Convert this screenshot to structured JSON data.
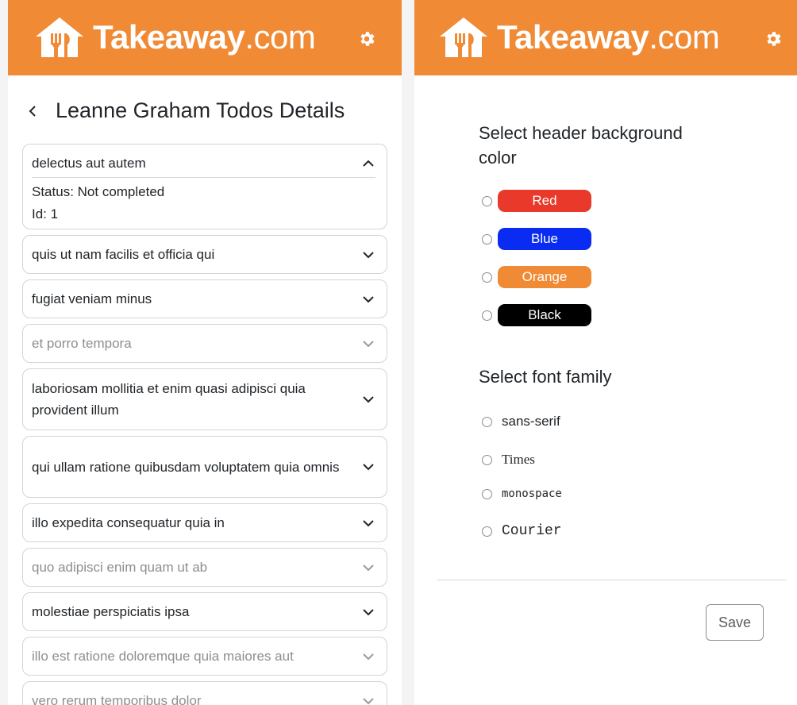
{
  "brand": {
    "primary": "#f08a35",
    "name_bold": "Takeaway",
    "name_light": ".com"
  },
  "left_panel": {
    "title": "Leanne Graham Todos Details",
    "todos": [
      {
        "title": "delectus aut autem",
        "completed": false,
        "expanded": true,
        "status_text": "Status: Not completed",
        "id_text": "Id: 1"
      },
      {
        "title": "quis ut nam facilis et officia qui",
        "completed": false
      },
      {
        "title": "fugiat veniam minus",
        "completed": false
      },
      {
        "title": "et porro tempora",
        "completed": true
      },
      {
        "title": "laboriosam mollitia et enim quasi adipisci quia provident illum",
        "completed": false
      },
      {
        "title": "qui ullam ratione quibusdam voluptatem quia omnis",
        "completed": false
      },
      {
        "title": "illo expedita consequatur quia in",
        "completed": false
      },
      {
        "title": "quo adipisci enim quam ut ab",
        "completed": true
      },
      {
        "title": "molestiae perspiciatis ipsa",
        "completed": false
      },
      {
        "title": "illo est ratione doloremque quia maiores aut",
        "completed": true
      },
      {
        "title": "vero rerum temporibus dolor",
        "completed": true
      }
    ]
  },
  "right_panel": {
    "color_heading": "Select header background color",
    "colors": [
      {
        "label": "Red",
        "hex": "#e8392b"
      },
      {
        "label": "Blue",
        "hex": "#0a2cf2"
      },
      {
        "label": "Orange",
        "hex": "#f08a35"
      },
      {
        "label": "Black",
        "hex": "#000000"
      }
    ],
    "font_heading": "Select font family",
    "fonts": [
      "sans-serif",
      "Times",
      "monospace",
      "Courier"
    ],
    "save_label": "Save"
  },
  "icons": {
    "logo": "takeaway-house-icon",
    "settings": "gear-icon",
    "back": "chevron-left-icon",
    "collapse": "chevron-up-icon",
    "expand": "chevron-down-icon"
  }
}
